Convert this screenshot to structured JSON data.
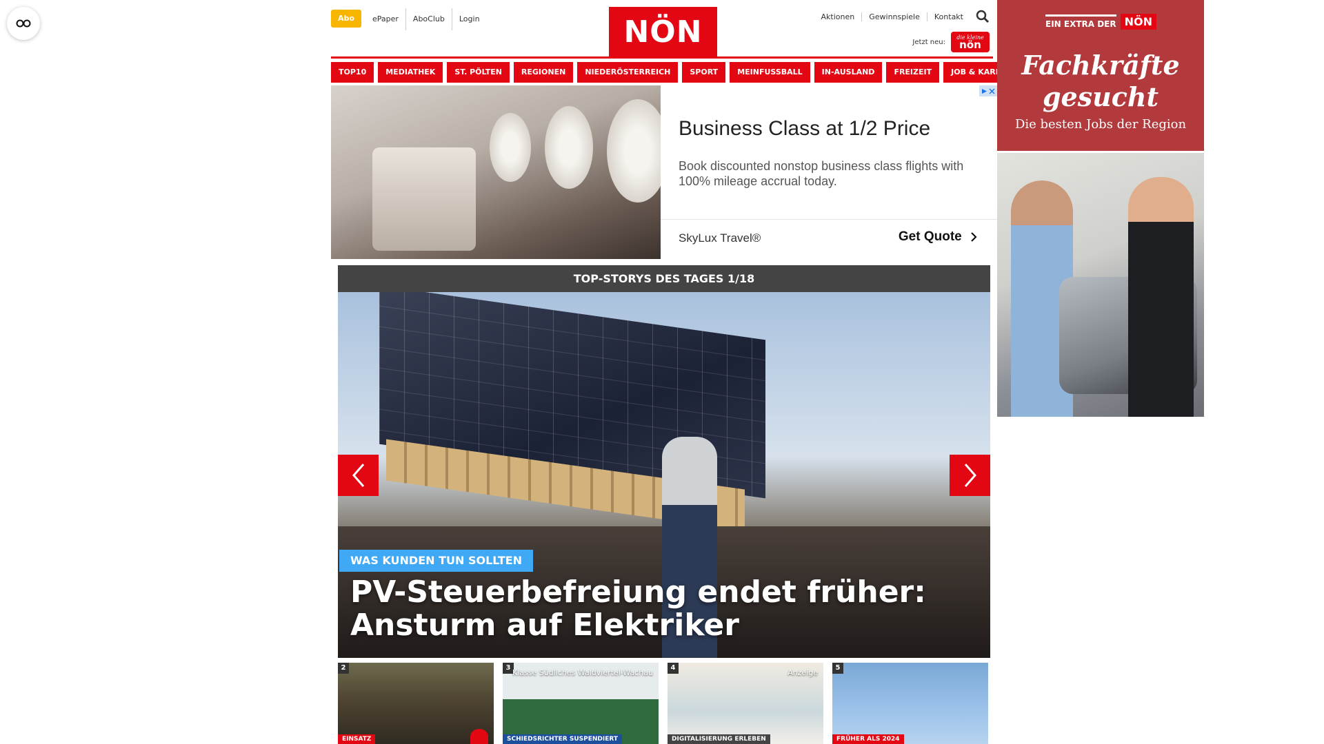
{
  "header": {
    "abo_label": "Abo",
    "links_left": [
      "ePaper",
      "AboClub",
      "Login"
    ],
    "logo_text": "NÖN",
    "links_right": [
      "Aktionen",
      "Gewinnspiele",
      "Kontakt"
    ],
    "jetzt_neu_label": "Jetzt neu:",
    "kleine_logo_small": "die kleine",
    "kleine_logo_text": "nön"
  },
  "nav": {
    "items": [
      "TOP10",
      "MEDIATHEK",
      "ST. PÖLTEN",
      "REGIONEN",
      "NIEDERÖSTERREICH",
      "SPORT",
      "MEINFUSSBALL",
      "IN-AUSLAND",
      "FREIZEIT",
      "JOB & KARRIERE"
    ]
  },
  "ad": {
    "headline": "Business Class at 1/2 Price",
    "description": "Book discounted nonstop business class flights with 100% mileage accrual today.",
    "brand": "SkyLux Travel®",
    "cta": "Get Quote"
  },
  "top_stories": {
    "header": "TOP-STORYS DES TAGES 1/18",
    "kicker": "WAS KUNDEN TUN SOLLTEN",
    "headline": "PV-Steuerbefreiung endet früher: Ansturm auf Elektriker"
  },
  "thumbs": [
    {
      "num": "2",
      "overlay": "",
      "tag": "EINSATZ",
      "tag_color": "#e30613"
    },
    {
      "num": "3",
      "overlay": "Klasse Südliches Waldviertel-Wachau",
      "tag": "SCHIEDSRICHTER SUSPENDIERT",
      "tag_color": "#1c4f9c"
    },
    {
      "num": "4",
      "overlay": "Anzeige",
      "tag": "DIGITALISIERUNG ERLEBEN",
      "tag_color": "#444444"
    },
    {
      "num": "5",
      "overlay": "",
      "tag": "FRÜHER ALS 2024",
      "tag_color": "#e30613"
    }
  ],
  "side_ad": {
    "badge_text": "EIN EXTRA DER",
    "badge_logo": "NÖN",
    "title_line1": "Fachkräfte",
    "title_line2": "gesucht",
    "subtitle": "Die besten Jobs der Region"
  },
  "colors": {
    "brand_red": "#e30613",
    "abo_yellow": "#f7b500",
    "kicker_blue": "#3fa9f5",
    "side_ad_red": "#b23a3c"
  }
}
